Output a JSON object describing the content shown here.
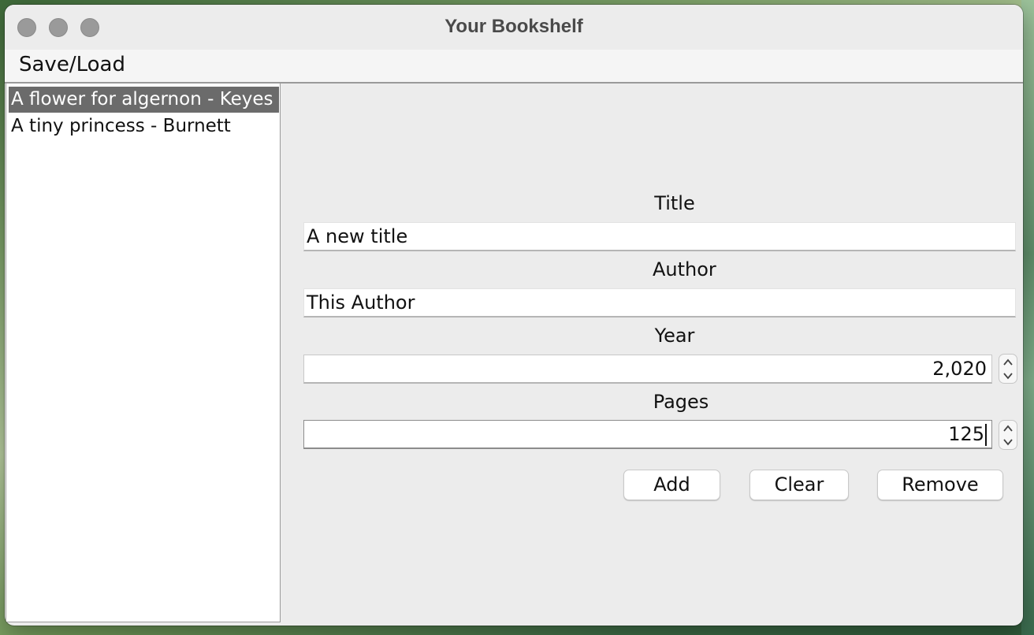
{
  "window": {
    "title": "Your Bookshelf"
  },
  "menubar": {
    "items": [
      "Save/Load"
    ]
  },
  "books": [
    {
      "label": "A flower for algernon - Keyes",
      "selected": true
    },
    {
      "label": "A tiny princess - Burnett",
      "selected": false
    }
  ],
  "form": {
    "title_label": "Title",
    "title_value": "A new title",
    "author_label": "Author",
    "author_value": "This Author",
    "year_label": "Year",
    "year_value": "2,020",
    "pages_label": "Pages",
    "pages_value": "125"
  },
  "buttons": {
    "add": "Add",
    "clear": "Clear",
    "remove": "Remove"
  },
  "colors": {
    "selection": "#6b6b6b",
    "window_bg": "#ececec"
  }
}
